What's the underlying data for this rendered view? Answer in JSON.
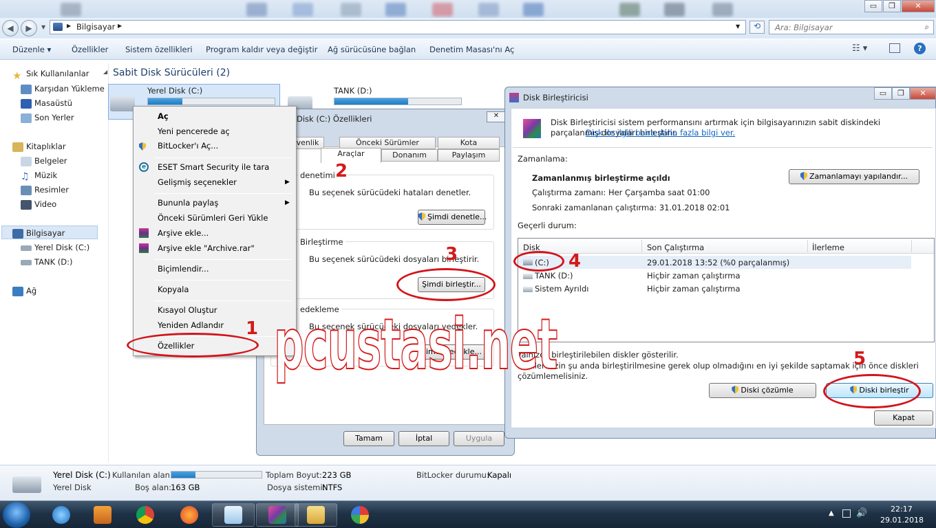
{
  "window": {
    "min": "▭",
    "max": "❐",
    "close": "✕"
  },
  "address": {
    "path": "Bilgisayar",
    "search_placeholder": "Ara: Bilgisayar"
  },
  "toolbar": {
    "organize": "Düzenle",
    "properties": "Özellikler",
    "system_props": "Sistem özellikleri",
    "uninstall": "Program kaldır veya değiştir",
    "map_drive": "Ağ sürücüsüne bağlan",
    "control_panel": "Denetim Masası'nı Aç"
  },
  "nav": {
    "favorites": "Sık Kullanılanlar",
    "downloads": "Karşıdan Yükleme",
    "desktop": "Masaüstü",
    "recent": "Son Yerler",
    "libraries": "Kitaplıklar",
    "documents": "Belgeler",
    "music": "Müzik",
    "pictures": "Resimler",
    "video": "Video",
    "computer": "Bilgisayar",
    "drive_c": "Yerel Disk (C:)",
    "drive_d": "TANK (D:)",
    "network": "Ağ"
  },
  "content": {
    "section": "Sabit Disk Sürücüleri (2)",
    "disk_c": "Yerel Disk (C:)",
    "disk_d": "TANK (D:)",
    "disk_c_fill": 0.27,
    "disk_d_fill": 0.58
  },
  "context_menu": {
    "items": [
      "Aç",
      "Yeni pencerede aç",
      "BitLocker'ı Aç...",
      "ESET Smart Security ile tara",
      "Gelişmiş seçenekler",
      "Bununla paylaş",
      "Önceki Sürümleri Geri Yükle",
      "Arşive ekle...",
      "Arşive ekle \"Archive.rar\"",
      "Biçimlendir...",
      "Kopyala",
      "Kısayol Oluştur",
      "Yeniden Adlandır",
      "Özellikler"
    ]
  },
  "props": {
    "title": "Disk (C:) Özellikleri",
    "close": "✕",
    "tabs": [
      "venlik",
      "Önceki Sürümler",
      "Kota",
      "Araçlar",
      "Donanım",
      "Paylaşım"
    ],
    "check_title": "denetimi",
    "check_text": "Bu seçenek sürücüdeki hataları denetler.",
    "check_btn": "Şimdi denetle...",
    "defrag_title": "Birleştirme",
    "defrag_text": "Bu seçenek sürücüdeki dosyaları birleştirir.",
    "defrag_btn": "Şimdi birleştir...",
    "backup_title": "edekleme",
    "backup_text": "Bu seçenek sürücüdeki dosyaları yedekler.",
    "backup_btn": "Şimdi yedekle...",
    "ok": "Tamam",
    "cancel": "İptal",
    "apply": "Uygula"
  },
  "defrag": {
    "title": "Disk Birleştiricisi",
    "intro": "Disk Birleştiricisi sistem performansını artırmak için bilgisayarınızın sabit diskindeki parçalanmış dosyaları birleştirir.",
    "link": "Disk ile ilgili bana daha fazla bilgi ver.",
    "schedule_label": "Zamanlama:",
    "schedule_on": "Zamanlanmış birleştirme açıldı",
    "run_at": "Çalıştırma zamanı: Her Çarşamba saat 01:00",
    "next_run": "Sonraki zamanlanan çalıştırma: 31.01.2018 02:01",
    "configure_btn": "Zamanlamayı yapılandır...",
    "status_label": "Geçerli durum:",
    "columns": [
      "Disk",
      "Son Çalıştırma",
      "İlerleme"
    ],
    "rows": [
      {
        "disk": "(C:)",
        "last": "29.01.2018 13:52 (%0 parçalanmış)"
      },
      {
        "disk": "TANK (D:)",
        "last": "Hiçbir zaman çalıştırma"
      },
      {
        "disk": "Sistem Ayrıldı",
        "last": "Hiçbir zaman çalıştırma"
      }
    ],
    "note1": "Yalnızca birleştirilebilen diskler gösterilir.",
    "note2": "Disklerinizin şu anda birleştirilmesine gerek olup olmadığını en iyi şekilde saptamak için önce diskleri",
    "note3": "çözümlemelisiniz.",
    "analyze_btn": "Diski çözümle",
    "defrag_btn": "Diski birleştir",
    "close_btn": "Kapat"
  },
  "annotations": {
    "n1": "1",
    "n2": "2",
    "n3": "3",
    "n4": "4",
    "n5": "5",
    "watermark": "pcustasi.net"
  },
  "details": {
    "name": "Yerel Disk (C:)",
    "type": "Yerel Disk",
    "used_label": "Kullanılan alan:",
    "used_fill": 0.27,
    "free_label": "Boş alan:",
    "free": "163 GB",
    "total_label": "Toplam Boyut:",
    "total": "223 GB",
    "fs_label": "Dosya sistemi:",
    "fs": "NTFS",
    "bitlocker_label": "BitLocker durumu:",
    "bitlocker": "Kapalı"
  },
  "taskbar": {
    "time": "22:17",
    "date": "29.01.2018"
  },
  "colors": {
    "accent": "#2678c5",
    "annotation": "#d3141b"
  }
}
